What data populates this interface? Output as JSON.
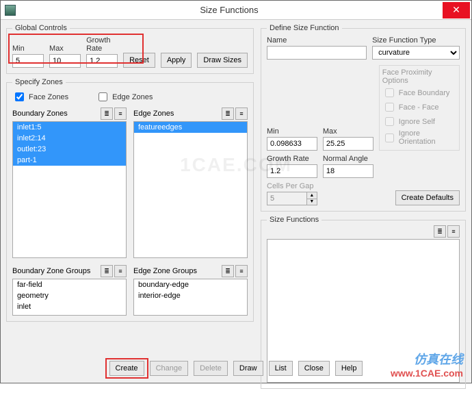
{
  "window": {
    "title": "Size Functions"
  },
  "global_controls": {
    "legend": "Global Controls",
    "min_label": "Min",
    "min_value": "5",
    "max_label": "Max",
    "max_value": "10",
    "growth_label": "Growth Rate",
    "growth_value": "1.2",
    "reset": "Reset",
    "apply": "Apply",
    "draw_sizes": "Draw Sizes"
  },
  "specify_zones": {
    "legend": "Specify Zones",
    "face_zones_chk": "Face Zones",
    "edge_zones_chk": "Edge Zones",
    "boundary_zones_label": "Boundary Zones",
    "edge_zones_label": "Edge Zones",
    "boundary_items": [
      "inlet1:5",
      "inlet2:14",
      "outlet:23",
      "part-1"
    ],
    "edge_items": [
      "featureedges"
    ],
    "boundary_groups_label": "Boundary Zone Groups",
    "edge_groups_label": "Edge Zone Groups",
    "boundary_groups": [
      "far-field",
      "geometry",
      "inlet"
    ],
    "edge_groups": [
      "boundary-edge",
      "interior-edge"
    ]
  },
  "define_sf": {
    "legend": "Define Size Function",
    "name_label": "Name",
    "name_value": "",
    "type_label": "Size Function Type",
    "type_value": "curvature",
    "min_label": "Min",
    "min_value": "0.098633",
    "max_label": "Max",
    "max_value": "25.25",
    "growth_label": "Growth Rate",
    "growth_value": "1.2",
    "normal_label": "Normal Angle",
    "normal_value": "18",
    "cells_gap_label": "Cells Per Gap",
    "cells_gap_value": "5",
    "face_prox_label": "Face Proximity Options",
    "fp_face_boundary": "Face Boundary",
    "fp_face_face": "Face - Face",
    "fp_ignore_self": "Ignore Self",
    "fp_ignore_orient": "Ignore Orientation",
    "create_defaults": "Create Defaults"
  },
  "sf_list": {
    "legend": "Size Functions"
  },
  "bottom": {
    "create": "Create",
    "change": "Change",
    "delete": "Delete",
    "draw": "Draw",
    "list": "List",
    "close": "Close",
    "help": "Help"
  },
  "watermark": {
    "wm1": "1CAE.COM",
    "wm2a": "仿真在线",
    "wm2b": "www.1CAE.com"
  }
}
